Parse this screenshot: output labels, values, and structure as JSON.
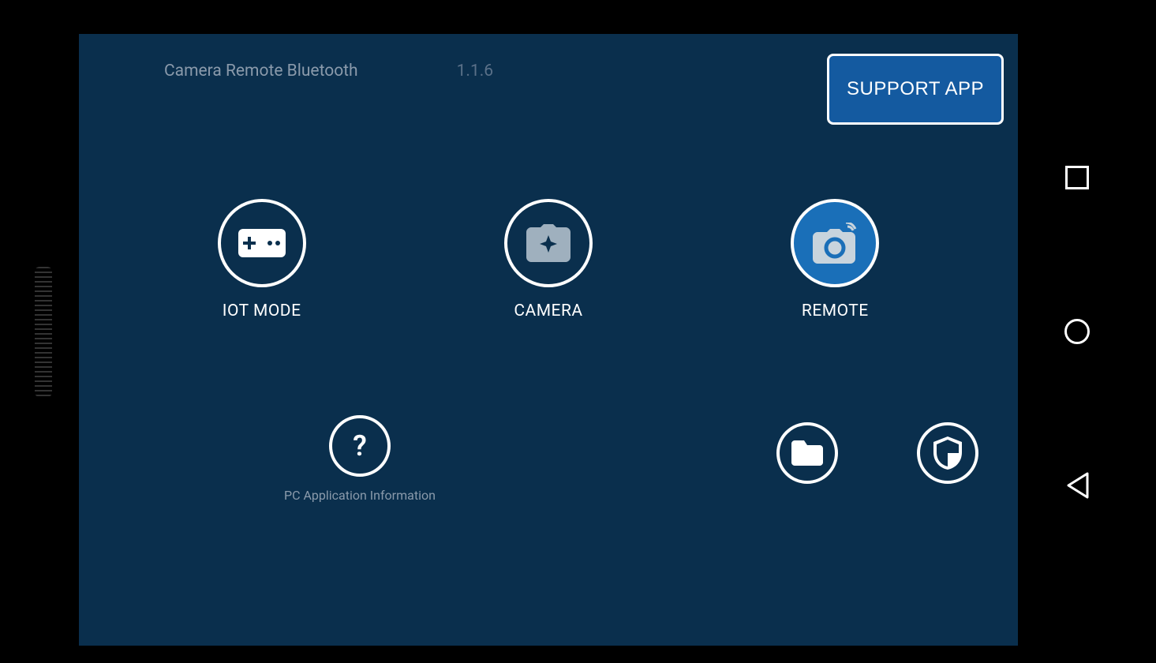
{
  "header": {
    "app_title": "Camera Remote Bluetooth",
    "version": "1.1.6",
    "support_button": "SUPPORT APP"
  },
  "modes": {
    "iot": {
      "label": "IOT MODE",
      "icon": "gamepad-icon",
      "active": false
    },
    "camera": {
      "label": "CAMERA",
      "icon": "camera-enhance-icon",
      "active": false
    },
    "remote": {
      "label": "REMOTE",
      "icon": "camera-remote-icon",
      "active": true
    }
  },
  "bottom": {
    "pc_info_label": "PC Application Information",
    "pc_info_icon": "question-icon",
    "folder_icon": "folder-icon",
    "shield_icon": "shield-icon"
  },
  "nav": {
    "recents": "recents-button",
    "home": "home-button",
    "back": "back-button"
  }
}
